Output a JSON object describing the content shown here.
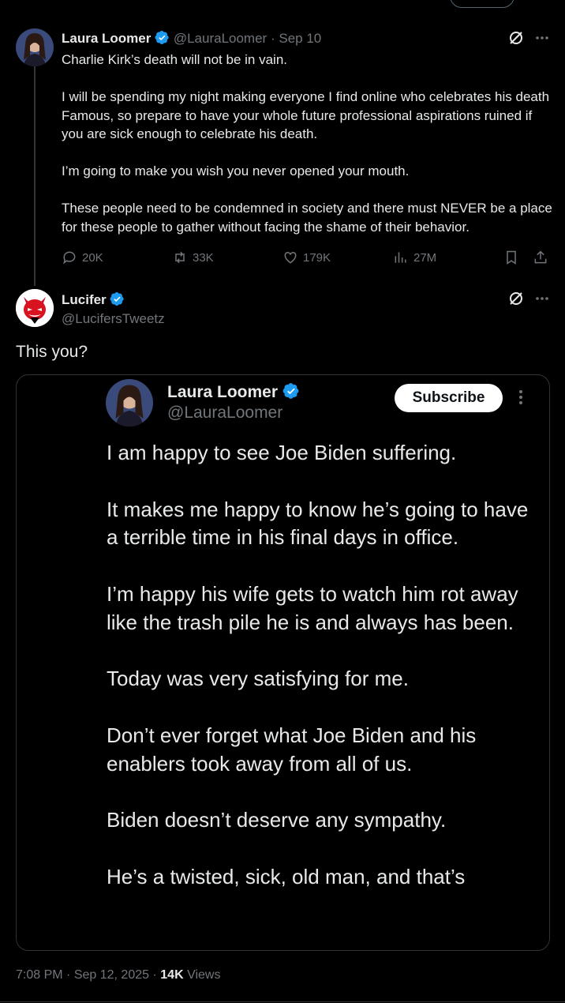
{
  "tweet": {
    "author_name": "Laura Loomer",
    "author_handle": "@LauraLoomer",
    "sep": "·",
    "date": "Sep 10",
    "paragraphs": [
      "Charlie Kirk’s death will not be in vain.",
      "I will be spending my night making everyone I find online who celebrates his death Famous, so prepare to have your whole future professional aspirations ruined if you are sick enough to celebrate his death.",
      "I’m going to make you wish you never opened your mouth.",
      "These people need to be condemned in society and there must NEVER be a place for these people to gather without facing the shame of their behavior."
    ],
    "replies": "20K",
    "reposts": "33K",
    "likes": "179K",
    "views": "27M"
  },
  "reply": {
    "author_name": "Lucifer",
    "author_handle": "@LucifersTweetz",
    "text": "This you?"
  },
  "quoted_post": {
    "author_name": "Laura Loomer",
    "author_handle": "@LauraLoomer",
    "subscribe_label": "Subscribe",
    "paragraphs": [
      "I am happy to see Joe Biden suffering.",
      "It makes me happy to know he’s going to have a terrible time in his final days in office.",
      "I’m happy his wife gets to watch him rot away like the trash pile he is and always has been.",
      "Today was very satisfying for me.",
      "Don’t ever forget what Joe Biden and his enablers took away from all of us.",
      "Biden doesn’t deserve any sympathy.",
      "He’s a twisted, sick, old man, and that’s"
    ]
  },
  "footer": {
    "time": "7:08 PM",
    "sep1": "·",
    "date": "Sep 12, 2025",
    "sep2": "·",
    "views_count": "14K",
    "views_label": "Views"
  },
  "colors": {
    "background": "#000000",
    "text": "#e7e9ea",
    "muted": "#71767b",
    "verified": "#1d9bf0",
    "border": "#2f3336"
  }
}
